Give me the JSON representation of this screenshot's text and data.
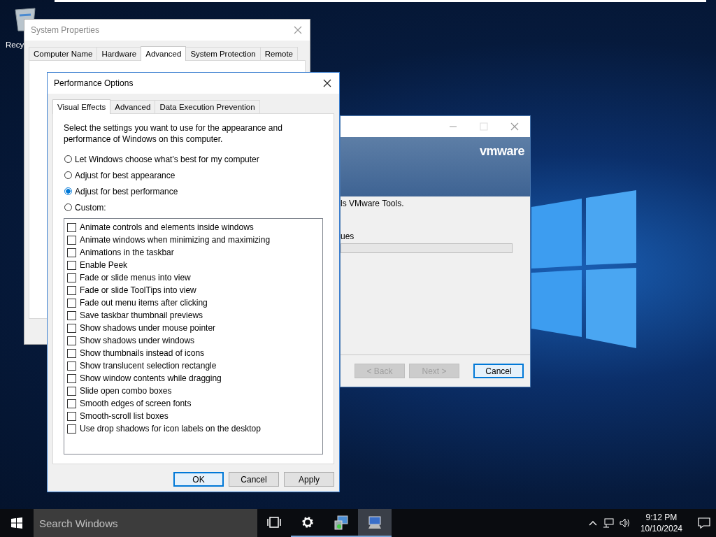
{
  "desktop": {
    "icons": [
      {
        "label": "Recy"
      }
    ]
  },
  "system_properties": {
    "title": "System Properties",
    "tabs": [
      {
        "label": "Computer Name",
        "selected": false
      },
      {
        "label": "Hardware",
        "selected": false
      },
      {
        "label": "Advanced",
        "selected": true
      },
      {
        "label": "System Protection",
        "selected": false
      },
      {
        "label": "Remote",
        "selected": false
      }
    ]
  },
  "vmware_setup": {
    "logo": "vmware",
    "texts": [
      "ls VMware Tools.",
      "ues"
    ],
    "progress": {
      "level": 0
    },
    "buttons": [
      {
        "label": "< Back",
        "disabled": true,
        "focused": false
      },
      {
        "label": "Next >",
        "disabled": true,
        "focused": false
      },
      {
        "label": "Cancel",
        "disabled": false,
        "focused": true
      }
    ]
  },
  "performance_options": {
    "title": "Performance Options",
    "tabs": [
      {
        "label": "Visual Effects",
        "selected": true
      },
      {
        "label": "Advanced",
        "selected": false
      },
      {
        "label": "Data Execution Prevention",
        "selected": false
      }
    ],
    "description": "Select the settings you want to use for the appearance and performance of Windows on this computer.",
    "options": [
      {
        "label": "Let Windows choose what's best for my computer",
        "selected": false
      },
      {
        "label": "Adjust for best appearance",
        "selected": false
      },
      {
        "label": "Adjust for best performance",
        "selected": true
      },
      {
        "label": "Custom:",
        "selected": false
      }
    ],
    "effects": [
      {
        "label": "Animate controls and elements inside windows",
        "checked": false
      },
      {
        "label": "Animate windows when minimizing and maximizing",
        "checked": false
      },
      {
        "label": "Animations in the taskbar",
        "checked": false
      },
      {
        "label": "Enable Peek",
        "checked": false
      },
      {
        "label": "Fade or slide menus into view",
        "checked": false
      },
      {
        "label": "Fade or slide ToolTips into view",
        "checked": false
      },
      {
        "label": "Fade out menu items after clicking",
        "checked": false
      },
      {
        "label": "Save taskbar thumbnail previews",
        "checked": false
      },
      {
        "label": "Show shadows under mouse pointer",
        "checked": false
      },
      {
        "label": "Show shadows under windows",
        "checked": false
      },
      {
        "label": "Show thumbnails instead of icons",
        "checked": false
      },
      {
        "label": "Show translucent selection rectangle",
        "checked": false
      },
      {
        "label": "Show window contents while dragging",
        "checked": false
      },
      {
        "label": "Slide open combo boxes",
        "checked": false
      },
      {
        "label": "Smooth edges of screen fonts",
        "checked": false
      },
      {
        "label": "Smooth-scroll list boxes",
        "checked": false
      },
      {
        "label": "Use drop shadows for icon labels on the desktop",
        "checked": false
      }
    ],
    "buttons": [
      {
        "label": "OK",
        "focused": true
      },
      {
        "label": "Cancel",
        "focused": false
      },
      {
        "label": "Apply",
        "focused": false
      }
    ]
  },
  "taskbar": {
    "search": {
      "placeholder": "Search Windows"
    },
    "apps": [
      {
        "kind": "task-view",
        "running": false,
        "active": false
      },
      {
        "kind": "settings",
        "running": true,
        "active": false
      },
      {
        "kind": "installer",
        "running": true,
        "active": false
      },
      {
        "kind": "computer",
        "running": true,
        "active": true
      }
    ],
    "clock": {
      "time": "9:12 PM",
      "date": "10/10/2024"
    }
  }
}
